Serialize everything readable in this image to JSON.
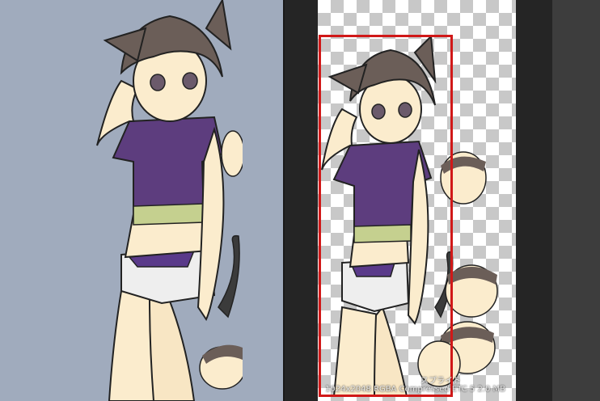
{
  "preview": {
    "sprite_label": "スプライト",
    "texture_info": "1024x2048 RGBA Compressed ETC 5   2.0 MB"
  }
}
